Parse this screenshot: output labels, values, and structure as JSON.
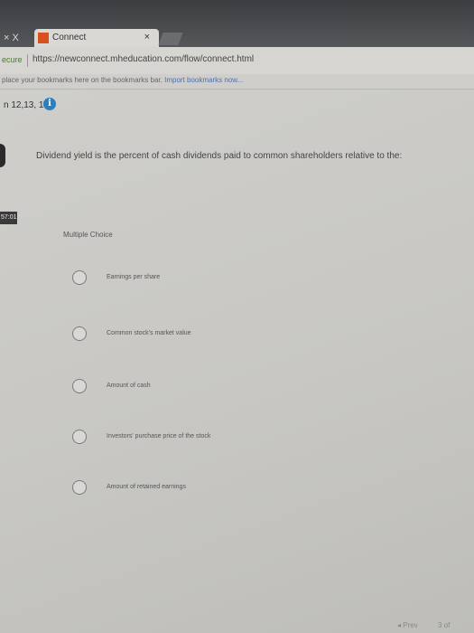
{
  "browser": {
    "tab_prev_text": "× X",
    "tab_title": "Connect",
    "tab_close": "×",
    "secure_label": "ecure",
    "url": "https://newconnect.mheducation.com/flow/connect.html",
    "bookmark_prompt": "place your bookmarks here on the bookmarks bar.",
    "bookmark_link": "Import bookmarks now..."
  },
  "question_header": {
    "numbers": "n 12,13, 14",
    "info_glyph": "i"
  },
  "timer": "57:01",
  "question": {
    "text": "Dividend yield is the percent of cash dividends paid to common shareholders relative to the:",
    "type_label": "Multiple Choice",
    "options": [
      {
        "label": "Earnings per share"
      },
      {
        "label": "Common stock's market value"
      },
      {
        "label": "Amount of cash"
      },
      {
        "label": "Investors' purchase price of the stock"
      },
      {
        "label": "Amount of retained earnings"
      }
    ]
  },
  "footer": {
    "prev_label": "◂ Prev",
    "page_count": "3 of"
  }
}
